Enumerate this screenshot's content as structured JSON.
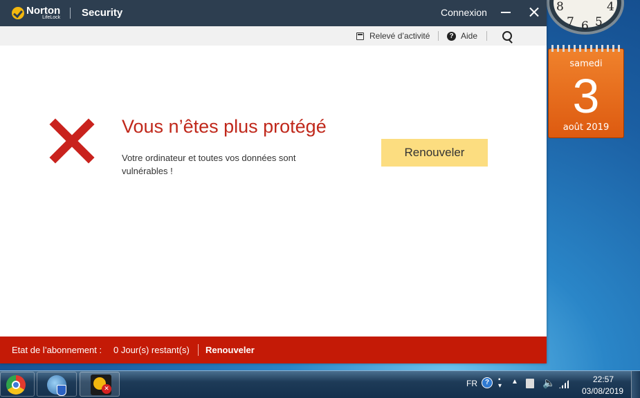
{
  "norton": {
    "logo_brand": "Norton",
    "logo_sub": "LifeLock",
    "product": "Security",
    "login_label": "Connexion",
    "toolbar": {
      "activity_label": "Relevé d’activité",
      "help_label": "Aide"
    },
    "alert": {
      "headline": "Vous n’êtes plus protégé",
      "description": "Votre ordinateur et toutes vos données sont vulnérables !",
      "renew_button": "Renouveler"
    },
    "status": {
      "subscription_label": "Etat de l’abonnement :",
      "days_remaining": "0 Jour(s) restant(s)",
      "renew_link": "Renouveler"
    },
    "colors": {
      "titlebar": "#2d3e50",
      "alert_red": "#c0281b",
      "statusbar_red": "#c41a06",
      "renew_button_yellow": "#fcdd80"
    }
  },
  "gadgets": {
    "clock_numbers": [
      "8",
      "7",
      "6",
      "5",
      "4"
    ],
    "calendar": {
      "weekday": "samedi",
      "day": "3",
      "month_year": "août 2019"
    }
  },
  "taskbar": {
    "apps": [
      "chrome-icon",
      "windows-update-icon",
      "norton-warning-icon"
    ],
    "tray": {
      "language": "FR",
      "help_glyph": "?",
      "time": "22:57",
      "date": "03/08/2019"
    }
  }
}
